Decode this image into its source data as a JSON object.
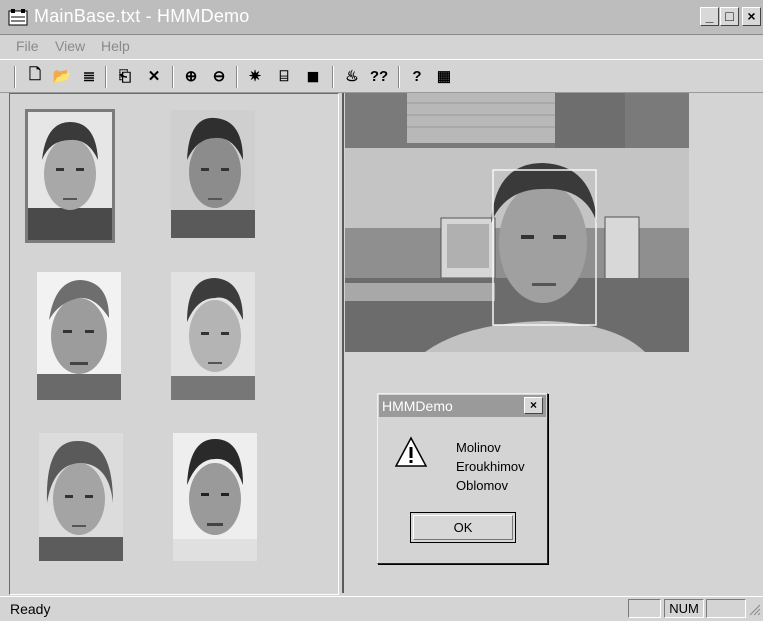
{
  "window": {
    "title": "MainBase.txt - HMMDemo",
    "minimize": "_",
    "maximize": "□",
    "close": "×"
  },
  "menu": [
    "File",
    "View",
    "Help"
  ],
  "toolbar": [
    {
      "name": "new-icon",
      "glyph": "🗋"
    },
    {
      "name": "open-icon",
      "glyph": "📂"
    },
    {
      "name": "list-icon",
      "glyph": "≣"
    },
    {
      "name": "add-person-icon",
      "glyph": "⎗"
    },
    {
      "name": "delete-icon",
      "glyph": "✕"
    },
    {
      "name": "zoom-in-icon",
      "glyph": "⊕"
    },
    {
      "name": "zoom-out-icon",
      "glyph": "⊖"
    },
    {
      "name": "eye-icon",
      "glyph": "✷"
    },
    {
      "name": "capture-icon",
      "glyph": "⌸"
    },
    {
      "name": "camera-icon",
      "glyph": "◼"
    },
    {
      "name": "train-icon",
      "glyph": "♨"
    },
    {
      "name": "recognize-icon",
      "glyph": "??"
    },
    {
      "name": "help-icon",
      "glyph": "?"
    },
    {
      "name": "grid-icon",
      "glyph": "▦"
    }
  ],
  "dialog": {
    "title": "HMMDemo",
    "close": "×",
    "names": [
      "Molinov",
      "Eroukhimov",
      "Oblomov"
    ],
    "ok": "OK"
  },
  "status": {
    "text": "Ready",
    "indicator": "NUM"
  }
}
